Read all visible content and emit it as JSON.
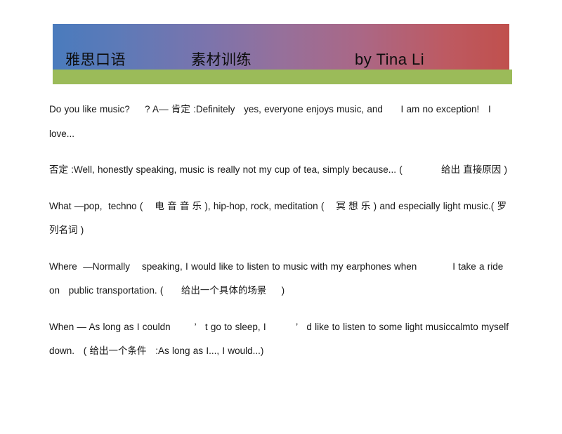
{
  "document": {
    "page_background": "#ffffff",
    "banner": {
      "gradient_start_color": "#4a7bbd",
      "gradient_mid_color": "#96709b",
      "gradient_end_color": "#c0504d",
      "underbar_color": "#9bbb59",
      "title_left": "雅思口语",
      "title_middle": "素材训练",
      "title_right": "by Tina Li"
    },
    "paragraphs": [
      {
        "id": "p-do-you-like-music",
        "text": "Do you like music?     ? A— 肯定 :Definitely   yes, everyone enjoys music, and      I am no exception!   I love..."
      },
      {
        "id": "p-negative-answer",
        "text": "否定 :Well, honestly speaking, music is really not my cup of tea, simply because... (             给出 直接原因 )"
      },
      {
        "id": "p-what",
        "text": "What —pop,  techno (    电 音 音 乐 ), hip-hop, rock, meditation (    冥 想 乐 ) and especially light music.( 罗列名词 )"
      },
      {
        "id": "p-where",
        "text": "Where  —Normally    speaking, I would like to listen to music with my earphones when            I take a ride on   public transportation. (      给出一个具体的场景     )"
      },
      {
        "id": "p-when",
        "text": "When — As long as I couldn        ’   t go to sleep, I          ’   d like to listen to some light musiccalmto myself down.   ( 给出一个条件   :As long as I..., I would...)"
      }
    ]
  }
}
